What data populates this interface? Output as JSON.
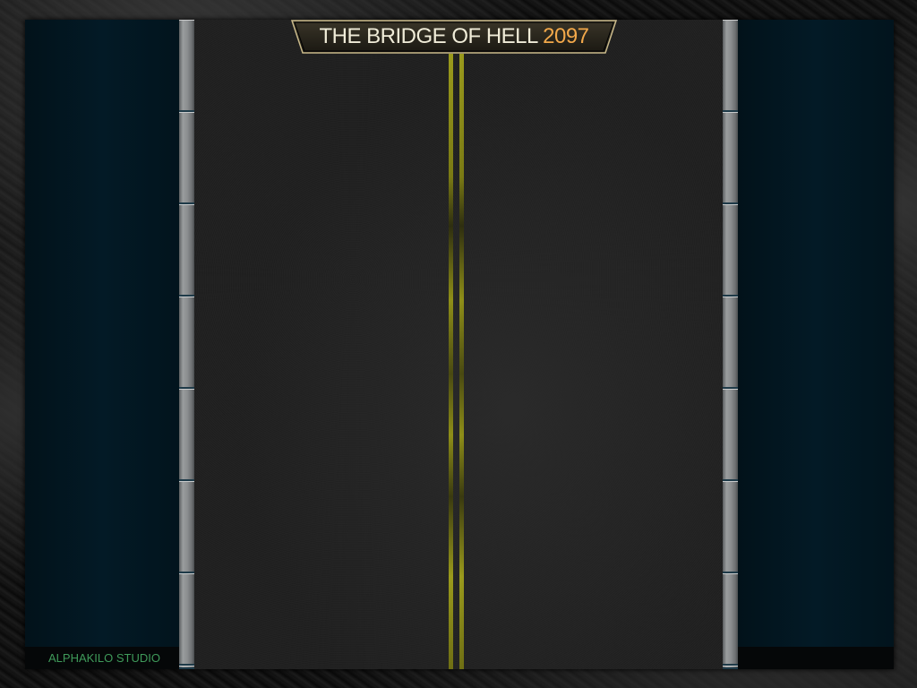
{
  "game": {
    "title_main": "THE BRIDGE OF HELL",
    "title_year": "2097",
    "studio": "ALPHAKILO STUDIO"
  },
  "colors": {
    "title_text": "#f0ecd8",
    "title_year": "#f2a84a",
    "studio_text": "#3f9a5a",
    "lane_line": "#9a9a1c",
    "water": "#031a26",
    "asphalt": "#222222"
  },
  "icons": {
    "title_plate": "banner-plate-icon"
  }
}
